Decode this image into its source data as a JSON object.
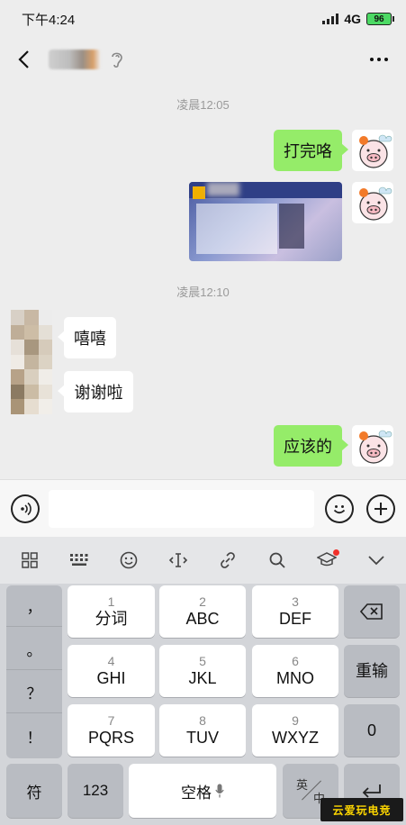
{
  "status_bar": {
    "time": "下午4:24",
    "network": "4G",
    "battery": "96"
  },
  "chat": {
    "messages": [
      {
        "time": "凌晨12:05"
      },
      {
        "from": "me",
        "text": "打完咯"
      },
      {
        "from": "me",
        "type": "image"
      },
      {
        "time": "凌晨12:10"
      },
      {
        "from": "them",
        "text": "嘻嘻"
      },
      {
        "from": "them",
        "text": "谢谢啦"
      },
      {
        "from": "me",
        "text": "应该的"
      }
    ]
  },
  "keyboard": {
    "punctuation": [
      "，",
      "。",
      "？",
      "！"
    ],
    "keys": [
      {
        "num": "1",
        "letters": "分词"
      },
      {
        "num": "2",
        "letters": "ABC"
      },
      {
        "num": "3",
        "letters": "DEF"
      },
      {
        "num": "4",
        "letters": "GHI"
      },
      {
        "num": "5",
        "letters": "JKL"
      },
      {
        "num": "6",
        "letters": "MNO"
      },
      {
        "num": "7",
        "letters": "PQRS"
      },
      {
        "num": "8",
        "letters": "TUV"
      },
      {
        "num": "9",
        "letters": "WXYZ"
      }
    ],
    "reenter": "重输",
    "zero": "0",
    "symbol": "符",
    "numbers": "123",
    "space": "空格",
    "lang_top": "英",
    "lang_bottom": "中"
  },
  "watermark": "云爱玩电竞",
  "colors": {
    "my_bubble": "#95ec69",
    "background": "#ededed",
    "red_dot": "#f0302a"
  }
}
